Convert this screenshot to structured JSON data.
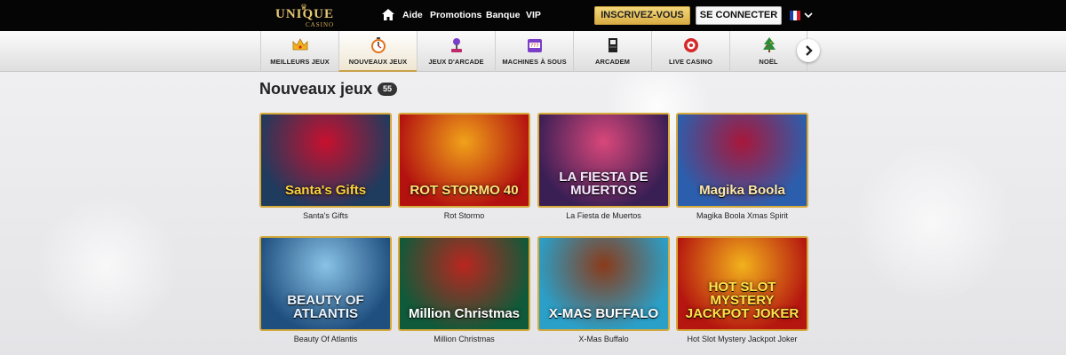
{
  "brand": {
    "logo_text": "UNIQUE",
    "logo_sub": "CASINO"
  },
  "topnav": {
    "links": [
      "Aide",
      "Promotions",
      "Banque",
      "VIP"
    ],
    "register_label": "INSCRIVEZ-VOUS",
    "login_label": "SE CONNECTER",
    "language": "FR"
  },
  "categories": [
    {
      "label": "MEILLEURS JEUX",
      "icon": "crown-icon",
      "active": false
    },
    {
      "label": "NOUVEAUX JEUX",
      "icon": "stopwatch-icon",
      "active": true
    },
    {
      "label": "JEUX D'ARCADE",
      "icon": "joystick-icon",
      "active": false
    },
    {
      "label": "MACHINES À SOUS",
      "icon": "slot-machine-icon",
      "active": false
    },
    {
      "label": "ARCADEM",
      "icon": "arcade-cabinet-icon",
      "active": false
    },
    {
      "label": "LIVE CASINO",
      "icon": "roulette-chip-icon",
      "active": false
    },
    {
      "label": "NOËL",
      "icon": "christmas-tree-icon",
      "active": false
    }
  ],
  "section": {
    "title": "Nouveaux jeux",
    "count": "55"
  },
  "games": [
    {
      "name": "Santa's Gifts",
      "art_text": "Santa's Gifts",
      "bg": "#1f3b5e",
      "accent": "#c8102e",
      "text_color": "#ffd33d"
    },
    {
      "name": "Rot Stormo",
      "art_text": "ROT STORMO 40",
      "bg": "#b3120f",
      "accent": "#f0a21a",
      "text_color": "#ffe27a"
    },
    {
      "name": "La Fiesta de Muertos",
      "art_text": "LA FIESTA DE MUERTOS",
      "bg": "#3a1f55",
      "accent": "#d9477a",
      "text_color": "#f7e9ff"
    },
    {
      "name": "Magika Boola Xmas Spirit",
      "art_text": "Magika Boola",
      "bg": "#2b5fae",
      "accent": "#a8173a",
      "text_color": "#ffe8a8"
    },
    {
      "name": "Beauty Of Atlantis",
      "art_text": "BEAUTY OF ATLANTIS",
      "bg": "#1f4f7f",
      "accent": "#89c2e6",
      "text_color": "#e8f4ff"
    },
    {
      "name": "Million Christmas",
      "art_text": "Million Christmas",
      "bg": "#0f5a3a",
      "accent": "#b9261f",
      "text_color": "#ffffff"
    },
    {
      "name": "X-Mas Buffalo",
      "art_text": "X-MAS BUFFALO",
      "bg": "#2aa0c9",
      "accent": "#8a3b1a",
      "text_color": "#ffffff"
    },
    {
      "name": "Hot Slot Mystery Jackpot Joker",
      "art_text": "HOT SLOT MYSTERY JACKPOT JOKER",
      "bg": "#b5160f",
      "accent": "#f2b21c",
      "text_color": "#ffe24a"
    }
  ]
}
